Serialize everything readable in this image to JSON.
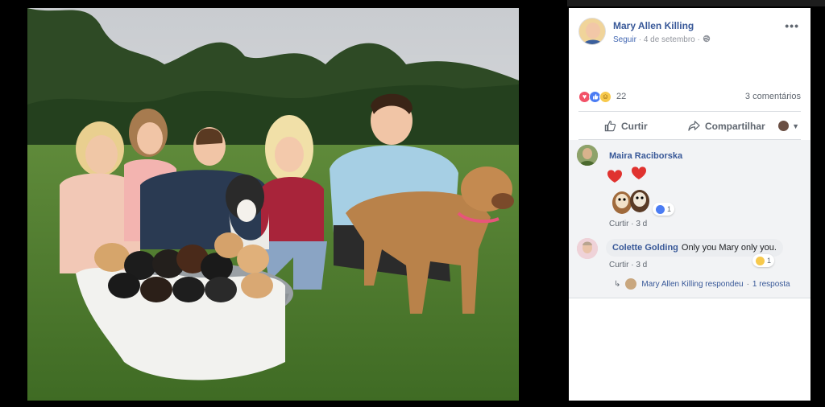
{
  "post": {
    "author": "Mary Allen Killing",
    "follow_label": "Seguir",
    "separator": "·",
    "date": "4 de setembro",
    "more_label": "•••"
  },
  "stats": {
    "reaction_count": "22",
    "comment_count": "3 comentários"
  },
  "actions": {
    "like_label": "Curtir",
    "share_label": "Compartilhar"
  },
  "comments": [
    {
      "name": "Maira Raciborska",
      "like_label": "Curtir",
      "time": "3 d",
      "reaction_count": "1"
    },
    {
      "name": "Colette Golding",
      "text": "Only you Mary only you.",
      "like_label": "Curtir",
      "time": "3 d",
      "reaction_count": "1"
    }
  ],
  "reply": {
    "text": "Mary Allen Killing respondeu",
    "separator": "·",
    "count": "1 resposta"
  },
  "icons": {
    "globe": "globe-icon",
    "like": "thumbs-up-icon",
    "share": "share-arrow-icon",
    "caret": "chevron-down-icon"
  },
  "colors": {
    "link": "#385898",
    "muted": "#606770",
    "panel_bg": "#ffffff",
    "comments_bg": "#f2f3f5"
  }
}
